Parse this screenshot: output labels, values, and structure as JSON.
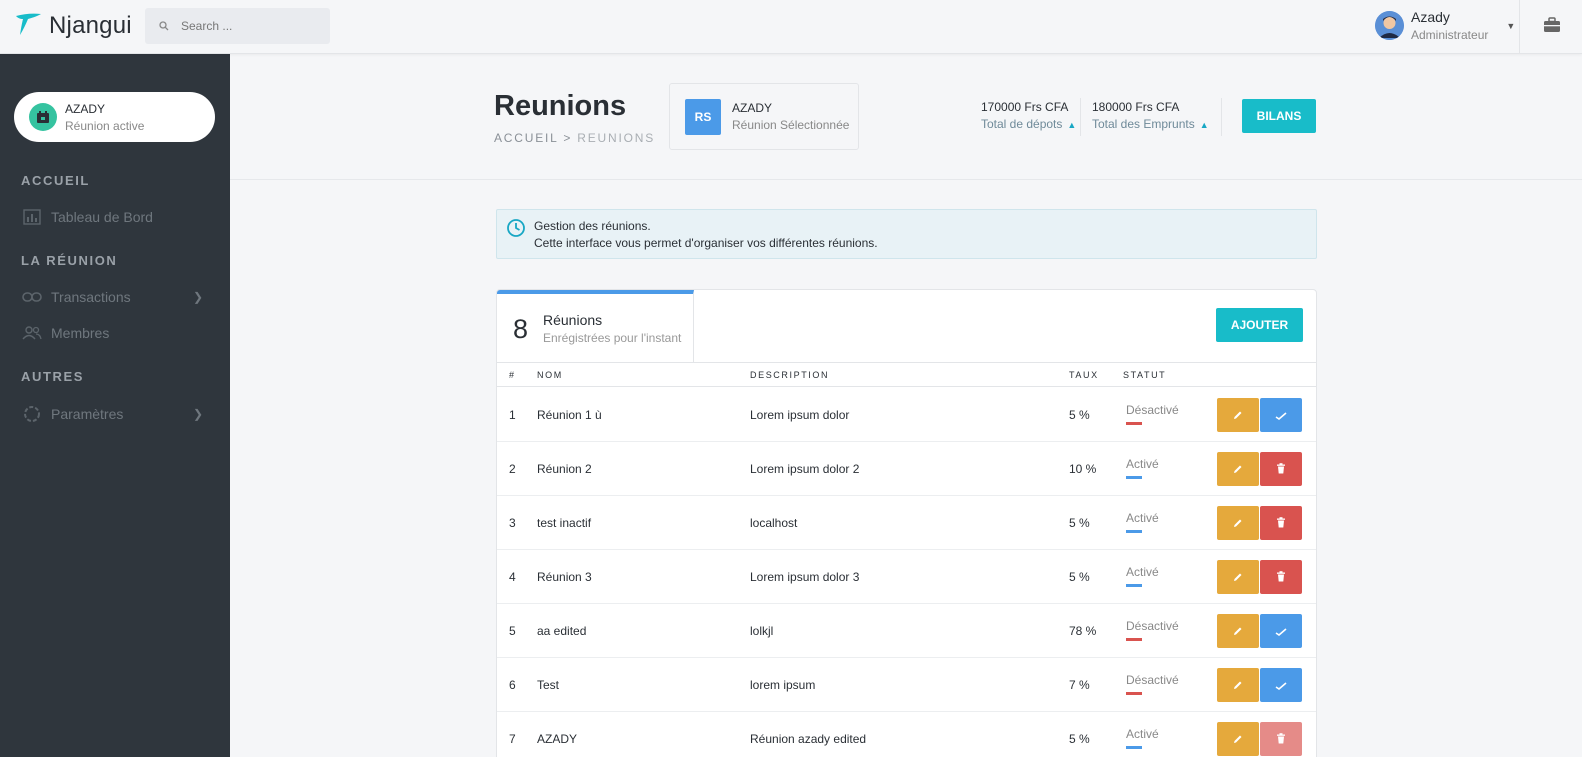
{
  "app": {
    "name": "Njangui"
  },
  "search": {
    "placeholder": "Search ..."
  },
  "user": {
    "name": "Azady",
    "role": "Administrateur"
  },
  "sidebar": {
    "active_card": {
      "name": "AZADY",
      "subtitle": "Réunion active"
    },
    "sections": [
      {
        "title": "ACCUEIL"
      },
      {
        "title": "LA RÉUNION"
      },
      {
        "title": "AUTRES"
      }
    ],
    "items": [
      {
        "label": "Tableau de Bord",
        "icon": "chart-icon"
      },
      {
        "label": "Transactions",
        "icon": "link-icon",
        "has_submenu": true
      },
      {
        "label": "Membres",
        "icon": "users-icon"
      },
      {
        "label": "Paramètres",
        "icon": "settings-icon",
        "has_submenu": true
      }
    ]
  },
  "header": {
    "title": "Reunions",
    "breadcrumb": {
      "home": "ACCUEIL",
      "separator": ">",
      "current": "REUNIONS"
    },
    "selected": {
      "badge": "RS",
      "name": "AZADY",
      "subtitle": "Réunion Sélectionnée"
    },
    "stats": [
      {
        "value": "170000 Frs CFA",
        "label": "Total de dépots"
      },
      {
        "value": "180000 Frs CFA",
        "label": "Total des Emprunts"
      }
    ],
    "bilans_label": "BILANS"
  },
  "info": {
    "line1": "Gestion des réunions.",
    "line2": "Cette interface vous permet d'organiser vos différentes réunions."
  },
  "table": {
    "count": "8",
    "count_label": "Réunions",
    "count_sub": "Enrégistrées pour l'instant",
    "add_label": "AJOUTER",
    "columns": [
      "#",
      "NOM",
      "DESCRIPTION",
      "TAUX",
      "STATUT"
    ],
    "rows": [
      {
        "num": "1",
        "nom": "Réunion 1 ù",
        "description": "Lorem ipsum dolor",
        "taux": "5 %",
        "statut": "Désactivé",
        "second_action": "activate"
      },
      {
        "num": "2",
        "nom": "Réunion 2",
        "description": "Lorem ipsum dolor 2",
        "taux": "10 %",
        "statut": "Activé",
        "second_action": "delete"
      },
      {
        "num": "3",
        "nom": "test inactif",
        "description": "localhost",
        "taux": "5 %",
        "statut": "Activé",
        "second_action": "delete"
      },
      {
        "num": "4",
        "nom": "Réunion 3",
        "description": "Lorem ipsum dolor 3",
        "taux": "5 %",
        "statut": "Activé",
        "second_action": "delete"
      },
      {
        "num": "5",
        "nom": "aa edited",
        "description": "lolkjl",
        "taux": "78 %",
        "statut": "Désactivé",
        "second_action": "activate"
      },
      {
        "num": "6",
        "nom": "Test",
        "description": "lorem ipsum",
        "taux": "7 %",
        "statut": "Désactivé",
        "second_action": "activate"
      },
      {
        "num": "7",
        "nom": "AZADY",
        "description": "Réunion azady edited",
        "taux": "5 %",
        "statut": "Activé",
        "second_action": "delete-disabled"
      }
    ]
  },
  "colors": {
    "accent": "#18bcc9",
    "primary": "#4b9ae8",
    "edit": "#e5a93c",
    "delete": "#d9534f",
    "delete_disabled": "#e58b88",
    "status_active": "#4b9ae8",
    "status_inactive": "#d9534f",
    "sidebar_bg": "#2f363d"
  }
}
